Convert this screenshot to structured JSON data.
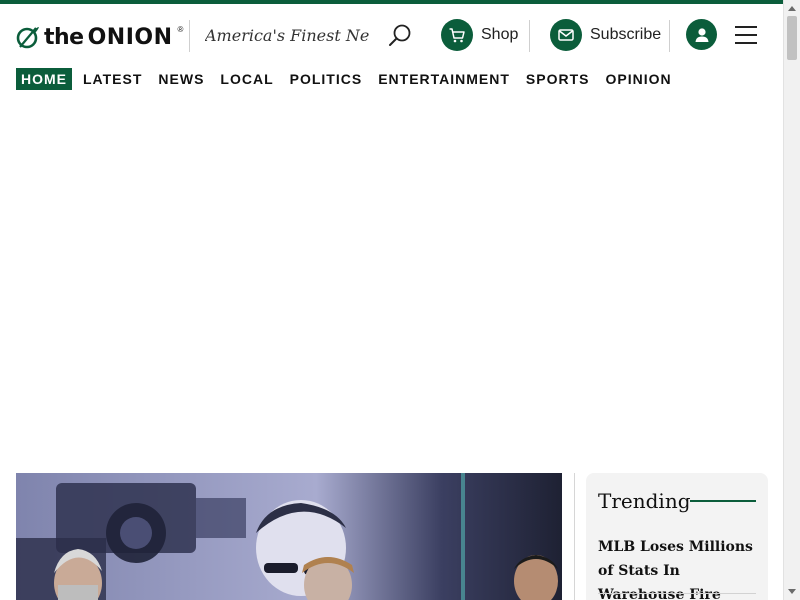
{
  "brand": {
    "logo_the": "the",
    "logo_onion": "ONION",
    "registered": "®",
    "tagline": "America's Finest Ne...",
    "brand_color": "#0b5d3b"
  },
  "header": {
    "search_icon": "search-icon",
    "shop_label": "Shop",
    "shop_icon": "cart-icon",
    "subscribe_label": "Subscribe",
    "subscribe_icon": "mail-icon",
    "account_icon": "user-icon",
    "menu_icon": "hamburger-icon"
  },
  "nav": {
    "items": [
      "HOME",
      "LATEST",
      "NEWS",
      "LOCAL",
      "POLITICS",
      "ENTERTAINMENT",
      "SPORTS",
      "OPINION"
    ],
    "active": "HOME"
  },
  "trending": {
    "title": "Trending",
    "items": [
      "MLB Loses Millions of Stats In Warehouse Fire"
    ]
  }
}
